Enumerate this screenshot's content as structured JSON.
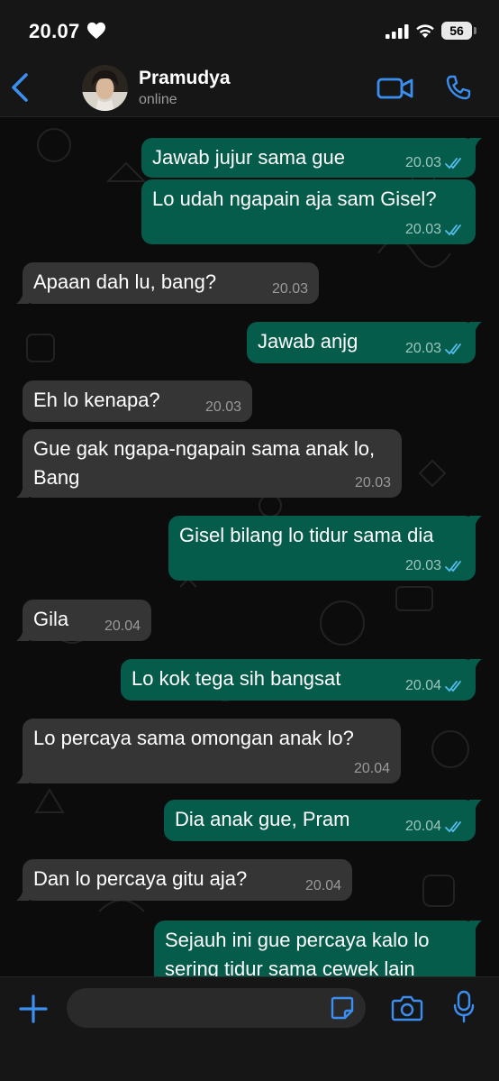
{
  "status_bar": {
    "time": "20.07",
    "battery": "56"
  },
  "header": {
    "contact_name": "Pramudya",
    "contact_status": "online"
  },
  "messages": [
    {
      "dir": "out",
      "text": "Jawab jujur sama gue",
      "time": "20.03"
    },
    {
      "dir": "out",
      "text": "Lo udah ngapain aja sam Gisel?",
      "time": "20.03"
    },
    {
      "dir": "in",
      "text": "Apaan dah lu, bang?",
      "time": "20.03"
    },
    {
      "dir": "out",
      "text": "Jawab anjg",
      "time": "20.03"
    },
    {
      "dir": "in",
      "text": "Eh lo kenapa?",
      "time": "20.03"
    },
    {
      "dir": "in",
      "text": "Gue gak ngapa-ngapain sama anak lo, Bang",
      "time": "20.03"
    },
    {
      "dir": "out",
      "text": "Gisel bilang lo tidur sama dia",
      "time": "20.03"
    },
    {
      "dir": "in",
      "text": "Gila",
      "time": "20.04"
    },
    {
      "dir": "out",
      "text": "Lo kok tega sih bangsat",
      "time": "20.04"
    },
    {
      "dir": "in",
      "text": "Lo percaya sama omongan anak lo?",
      "time": "20.04"
    },
    {
      "dir": "out",
      "text": "Dia anak gue, Pram",
      "time": "20.04"
    },
    {
      "dir": "in",
      "text": "Dan lo percaya gitu aja?",
      "time": "20.04"
    },
    {
      "dir": "out",
      "text": "Sejauh ini gue percaya kalo lo sering tidur sama cewek lain",
      "time": ""
    }
  ],
  "input": {
    "placeholder": ""
  },
  "icons": {
    "back": "chevron-left-icon",
    "video": "video-camera-icon",
    "call": "phone-icon",
    "plus": "plus-icon",
    "sticker": "sticker-icon",
    "camera": "camera-icon",
    "mic": "microphone-icon"
  },
  "colors": {
    "accent": "#3b8ff0",
    "outgoing_bubble": "#065c4b",
    "incoming_bubble": "#353535",
    "read_ticks": "#53bdeb"
  }
}
